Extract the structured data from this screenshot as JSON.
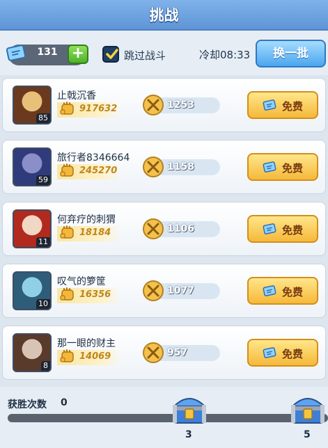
{
  "header": {
    "title": "挑战"
  },
  "topbar": {
    "tickets": "131",
    "plus_label": "+",
    "skip_battle": "跳过战斗",
    "cooldown": "冷却08:33",
    "refresh": "换一批"
  },
  "opponents": [
    {
      "name": "止戟沉香",
      "level": "85",
      "power": "917632",
      "score": "1253",
      "action": "免费"
    },
    {
      "name": "旅行者8346664",
      "level": "59",
      "power": "245270",
      "score": "1158",
      "action": "免费"
    },
    {
      "name": "何弃疗的刺猬",
      "level": "11",
      "power": "18184",
      "score": "1106",
      "action": "免费"
    },
    {
      "name": "叹气的箩筐",
      "level": "10",
      "power": "16356",
      "score": "1077",
      "action": "免费"
    },
    {
      "name": "那一眼的财主",
      "level": "8",
      "power": "14069",
      "score": "957",
      "action": "免费"
    }
  ],
  "footer": {
    "wins_label": "获胜次数",
    "wins_value": "0",
    "chest1": "3",
    "chest2": "5"
  },
  "colors": {
    "accent_blue": "#5f95d6",
    "gold_button": "#f5b93a",
    "green_plus": "#4fb22b"
  }
}
